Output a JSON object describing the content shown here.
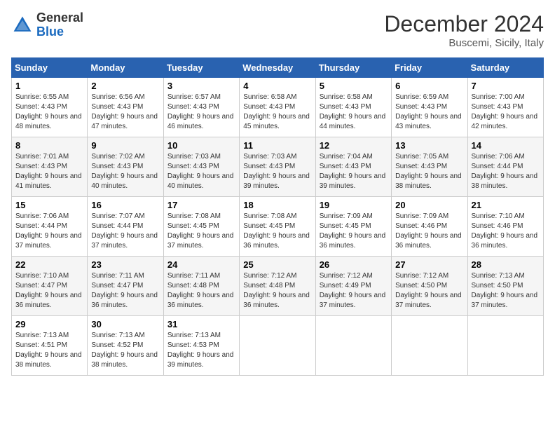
{
  "header": {
    "logo_line1": "General",
    "logo_line2": "Blue",
    "month": "December 2024",
    "location": "Buscemi, Sicily, Italy"
  },
  "weekdays": [
    "Sunday",
    "Monday",
    "Tuesday",
    "Wednesday",
    "Thursday",
    "Friday",
    "Saturday"
  ],
  "weeks": [
    [
      {
        "day": "1",
        "sunrise": "6:55 AM",
        "sunset": "4:43 PM",
        "daylight": "9 hours and 48 minutes."
      },
      {
        "day": "2",
        "sunrise": "6:56 AM",
        "sunset": "4:43 PM",
        "daylight": "9 hours and 47 minutes."
      },
      {
        "day": "3",
        "sunrise": "6:57 AM",
        "sunset": "4:43 PM",
        "daylight": "9 hours and 46 minutes."
      },
      {
        "day": "4",
        "sunrise": "6:58 AM",
        "sunset": "4:43 PM",
        "daylight": "9 hours and 45 minutes."
      },
      {
        "day": "5",
        "sunrise": "6:58 AM",
        "sunset": "4:43 PM",
        "daylight": "9 hours and 44 minutes."
      },
      {
        "day": "6",
        "sunrise": "6:59 AM",
        "sunset": "4:43 PM",
        "daylight": "9 hours and 43 minutes."
      },
      {
        "day": "7",
        "sunrise": "7:00 AM",
        "sunset": "4:43 PM",
        "daylight": "9 hours and 42 minutes."
      }
    ],
    [
      {
        "day": "8",
        "sunrise": "7:01 AM",
        "sunset": "4:43 PM",
        "daylight": "9 hours and 41 minutes."
      },
      {
        "day": "9",
        "sunrise": "7:02 AM",
        "sunset": "4:43 PM",
        "daylight": "9 hours and 40 minutes."
      },
      {
        "day": "10",
        "sunrise": "7:03 AM",
        "sunset": "4:43 PM",
        "daylight": "9 hours and 40 minutes."
      },
      {
        "day": "11",
        "sunrise": "7:03 AM",
        "sunset": "4:43 PM",
        "daylight": "9 hours and 39 minutes."
      },
      {
        "day": "12",
        "sunrise": "7:04 AM",
        "sunset": "4:43 PM",
        "daylight": "9 hours and 39 minutes."
      },
      {
        "day": "13",
        "sunrise": "7:05 AM",
        "sunset": "4:43 PM",
        "daylight": "9 hours and 38 minutes."
      },
      {
        "day": "14",
        "sunrise": "7:06 AM",
        "sunset": "4:44 PM",
        "daylight": "9 hours and 38 minutes."
      }
    ],
    [
      {
        "day": "15",
        "sunrise": "7:06 AM",
        "sunset": "4:44 PM",
        "daylight": "9 hours and 37 minutes."
      },
      {
        "day": "16",
        "sunrise": "7:07 AM",
        "sunset": "4:44 PM",
        "daylight": "9 hours and 37 minutes."
      },
      {
        "day": "17",
        "sunrise": "7:08 AM",
        "sunset": "4:45 PM",
        "daylight": "9 hours and 37 minutes."
      },
      {
        "day": "18",
        "sunrise": "7:08 AM",
        "sunset": "4:45 PM",
        "daylight": "9 hours and 36 minutes."
      },
      {
        "day": "19",
        "sunrise": "7:09 AM",
        "sunset": "4:45 PM",
        "daylight": "9 hours and 36 minutes."
      },
      {
        "day": "20",
        "sunrise": "7:09 AM",
        "sunset": "4:46 PM",
        "daylight": "9 hours and 36 minutes."
      },
      {
        "day": "21",
        "sunrise": "7:10 AM",
        "sunset": "4:46 PM",
        "daylight": "9 hours and 36 minutes."
      }
    ],
    [
      {
        "day": "22",
        "sunrise": "7:10 AM",
        "sunset": "4:47 PM",
        "daylight": "9 hours and 36 minutes."
      },
      {
        "day": "23",
        "sunrise": "7:11 AM",
        "sunset": "4:47 PM",
        "daylight": "9 hours and 36 minutes."
      },
      {
        "day": "24",
        "sunrise": "7:11 AM",
        "sunset": "4:48 PM",
        "daylight": "9 hours and 36 minutes."
      },
      {
        "day": "25",
        "sunrise": "7:12 AM",
        "sunset": "4:48 PM",
        "daylight": "9 hours and 36 minutes."
      },
      {
        "day": "26",
        "sunrise": "7:12 AM",
        "sunset": "4:49 PM",
        "daylight": "9 hours and 37 minutes."
      },
      {
        "day": "27",
        "sunrise": "7:12 AM",
        "sunset": "4:50 PM",
        "daylight": "9 hours and 37 minutes."
      },
      {
        "day": "28",
        "sunrise": "7:13 AM",
        "sunset": "4:50 PM",
        "daylight": "9 hours and 37 minutes."
      }
    ],
    [
      {
        "day": "29",
        "sunrise": "7:13 AM",
        "sunset": "4:51 PM",
        "daylight": "9 hours and 38 minutes."
      },
      {
        "day": "30",
        "sunrise": "7:13 AM",
        "sunset": "4:52 PM",
        "daylight": "9 hours and 38 minutes."
      },
      {
        "day": "31",
        "sunrise": "7:13 AM",
        "sunset": "4:53 PM",
        "daylight": "9 hours and 39 minutes."
      },
      null,
      null,
      null,
      null
    ]
  ]
}
